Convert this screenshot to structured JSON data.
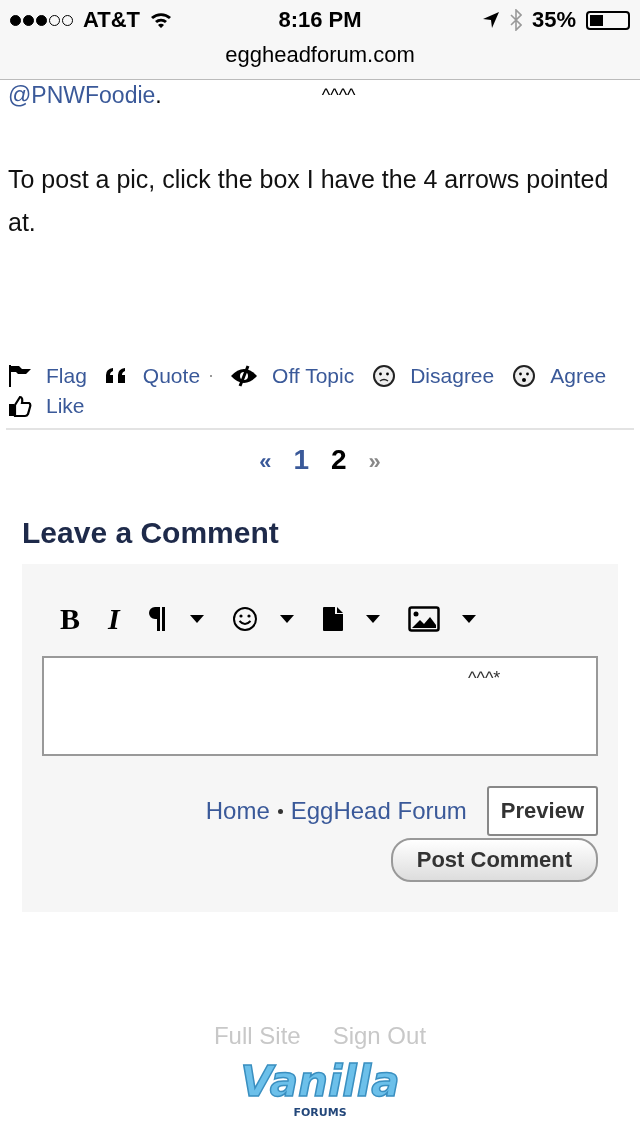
{
  "status_bar": {
    "carrier": "AT&T",
    "time": "8:16 PM",
    "battery": "35%"
  },
  "address_bar": {
    "url": "eggheadforum.com"
  },
  "post": {
    "mention": "@PNWFoodie",
    "after_mention": ".",
    "carets": "^^^^",
    "body": "To post a pic, click the box I have the 4 arrows pointed at."
  },
  "reactions": [
    {
      "kind": "flag",
      "label": "Flag"
    },
    {
      "kind": "quote",
      "label": "Quote"
    },
    {
      "kind": "offtopic",
      "label": "Off Topic"
    },
    {
      "kind": "disagree",
      "label": "Disagree"
    },
    {
      "kind": "agree",
      "label": "Agree"
    },
    {
      "kind": "like",
      "label": "Like"
    }
  ],
  "pagination": [
    {
      "kind": "prev",
      "label": "«",
      "selected": false,
      "disabled": false
    },
    {
      "kind": "page",
      "label": "1",
      "selected": false,
      "disabled": false
    },
    {
      "kind": "page",
      "label": "2",
      "selected": true,
      "disabled": false
    },
    {
      "kind": "next",
      "label": "»",
      "selected": false,
      "disabled": true
    }
  ],
  "comment": {
    "heading": "Leave a Comment",
    "toolbar": [
      {
        "kind": "bold",
        "label": "B",
        "dropdown": false
      },
      {
        "kind": "italic",
        "label": "I",
        "dropdown": false
      },
      {
        "kind": "paragraph",
        "dropdown": true
      },
      {
        "kind": "emoji",
        "dropdown": true
      },
      {
        "kind": "file",
        "dropdown": true
      },
      {
        "kind": "image",
        "dropdown": true
      }
    ],
    "value": "^^^*",
    "breadcrumbs": [
      {
        "label": "Home"
      },
      {
        "label": "EggHead Forum"
      }
    ],
    "preview": "Preview",
    "submit": "Post Comment"
  },
  "footer": {
    "links": [
      {
        "label": "Full Site"
      },
      {
        "label": "Sign Out"
      }
    ],
    "logo": {
      "wordmark": "Vanilla",
      "caption": "FORUMS"
    }
  }
}
